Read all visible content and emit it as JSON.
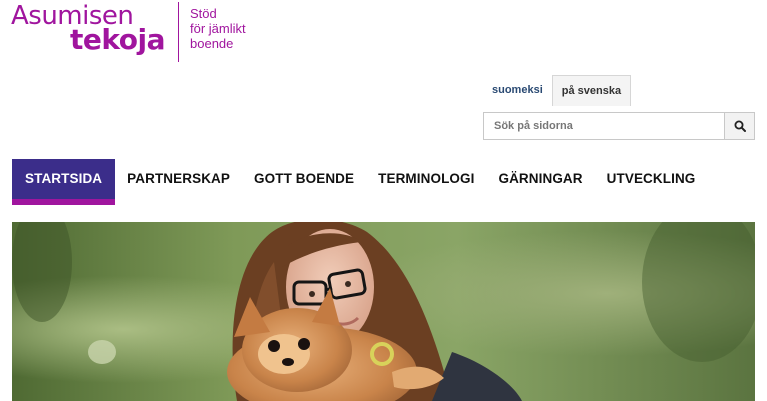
{
  "logo": {
    "word1": "Asumisen",
    "word2": "tekoja",
    "tagline": [
      "Stöd",
      "för jämlikt",
      "boende"
    ]
  },
  "language": {
    "items": [
      {
        "label": "suomeksi",
        "active": false
      },
      {
        "label": "på svenska",
        "active": true
      }
    ]
  },
  "search": {
    "placeholder": "Sök på sidorna",
    "icon": "search-icon"
  },
  "nav": {
    "items": [
      {
        "label": "STARTSIDA",
        "active": true
      },
      {
        "label": "PARTNERSKAP",
        "active": false
      },
      {
        "label": "GOTT BOENDE",
        "active": false
      },
      {
        "label": "TERMINOLOGI",
        "active": false
      },
      {
        "label": "GÄRNINGAR",
        "active": false
      },
      {
        "label": "UTVECKLING",
        "active": false
      }
    ]
  },
  "colors": {
    "brand": "#a0159e",
    "nav_active_bg": "#3b2d8a",
    "link": "#2a4a73"
  }
}
